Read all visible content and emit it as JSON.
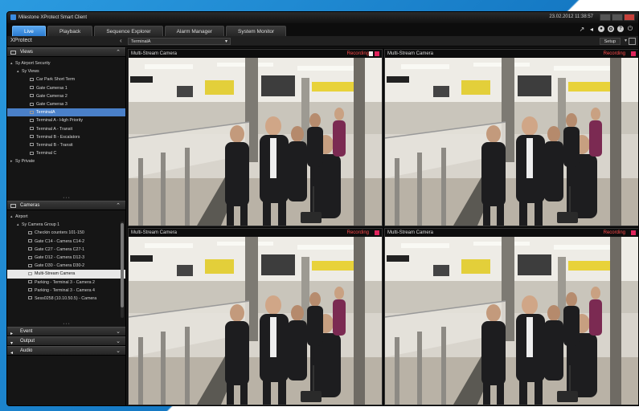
{
  "window": {
    "title": "Milestone XProtect Smart Client",
    "clock": "23.02.2012 11:38:57"
  },
  "tabs": [
    {
      "label": "Live",
      "active": true
    },
    {
      "label": "Playback",
      "active": false
    },
    {
      "label": "Sequence Explorer",
      "active": false
    },
    {
      "label": "Alarm Manager",
      "active": false
    },
    {
      "label": "System Monitor",
      "active": false
    }
  ],
  "subbar": {
    "product": "XProtect",
    "view_selector": "TerminalA",
    "setup_label": "Setup"
  },
  "views_panel": {
    "title": "Views",
    "nodes": [
      {
        "label": "Sy Airport Security",
        "glyph": "▴"
      },
      {
        "label": "Sy Views",
        "glyph": "▴"
      },
      {
        "label": "Car Park Short Term",
        "glyph": ""
      },
      {
        "label": "Gate Cameras 1",
        "glyph": ""
      },
      {
        "label": "Gate Cameras 2",
        "glyph": ""
      },
      {
        "label": "Gate Cameras 3",
        "glyph": ""
      },
      {
        "label": "TerminalA",
        "glyph": ""
      },
      {
        "label": "Terminal A - High Priority",
        "glyph": ""
      },
      {
        "label": "Terminal A - Transit",
        "glyph": ""
      },
      {
        "label": "Terminal B - Escalators",
        "glyph": ""
      },
      {
        "label": "Terminal B - Transit",
        "glyph": ""
      },
      {
        "label": "Terminal C",
        "glyph": ""
      },
      {
        "label": "Sy Private",
        "glyph": "▸"
      }
    ]
  },
  "cameras_panel": {
    "title": "Cameras",
    "nodes": [
      {
        "label": "Airport",
        "glyph": "▴"
      },
      {
        "label": "Sy Camera Group 1",
        "glyph": "▴"
      },
      {
        "label": "Checkin counters 101-150",
        "glyph": ""
      },
      {
        "label": "Gate C14 - Camera C14-2",
        "glyph": ""
      },
      {
        "label": "Gate C27 - Camera C27-1",
        "glyph": ""
      },
      {
        "label": "Gate D12 - Camera D12-3",
        "glyph": ""
      },
      {
        "label": "Gate D30 - Camera D30-2",
        "glyph": ""
      },
      {
        "label": "Multi-Stream Camera",
        "glyph": ""
      },
      {
        "label": "Parking - Terminal 3 - Camera 2",
        "glyph": ""
      },
      {
        "label": "Parking - Terminal 3 - Camera 4",
        "glyph": ""
      },
      {
        "label": "Sess0258 (10.10.50.5) - Camera",
        "glyph": ""
      }
    ]
  },
  "collapsed_sections": [
    {
      "title": "Event"
    },
    {
      "title": "Output"
    },
    {
      "title": "Audio"
    }
  ],
  "camera_tiles": [
    {
      "name": "Multi-Stream Camera",
      "status": "Recording"
    },
    {
      "name": "Multi-Stream Camera",
      "status": "Recording"
    },
    {
      "name": "Multi-Stream Camera",
      "status": "Recording"
    },
    {
      "name": "Multi-Stream Camera",
      "status": "Recording"
    }
  ],
  "colors": {
    "accent": "#2b7bd0",
    "selected_row": "#4a80c8",
    "recording": "#ff4a4a"
  }
}
